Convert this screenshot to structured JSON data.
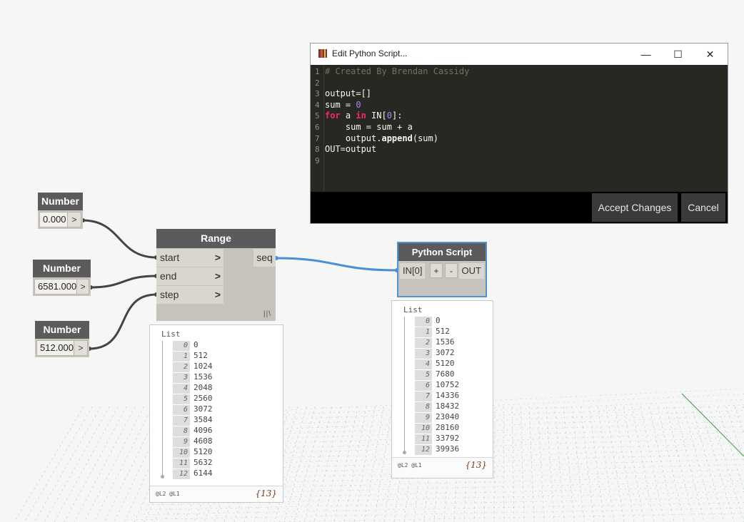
{
  "number_nodes": [
    {
      "title": "Number",
      "value": "0.000",
      "arrow": ">"
    },
    {
      "title": "Number",
      "value": "6581.000",
      "arrow": ">"
    },
    {
      "title": "Number",
      "value": "512.000",
      "arrow": ">"
    }
  ],
  "range_node": {
    "title": "Range",
    "inputs": [
      "start",
      "end",
      "step"
    ],
    "chevron": ">",
    "output": "seq",
    "lacing": "||\\"
  },
  "range_preview": {
    "title": "List",
    "items": [
      {
        "idx": "0",
        "val": "0"
      },
      {
        "idx": "1",
        "val": "512"
      },
      {
        "idx": "2",
        "val": "1024"
      },
      {
        "idx": "3",
        "val": "1536"
      },
      {
        "idx": "4",
        "val": "2048"
      },
      {
        "idx": "5",
        "val": "2560"
      },
      {
        "idx": "6",
        "val": "3072"
      },
      {
        "idx": "7",
        "val": "3584"
      },
      {
        "idx": "8",
        "val": "4096"
      },
      {
        "idx": "9",
        "val": "4608"
      },
      {
        "idx": "10",
        "val": "5120"
      },
      {
        "idx": "11",
        "val": "5632"
      },
      {
        "idx": "12",
        "val": "6144"
      }
    ],
    "levels": "@L2 @L1",
    "count": "{13}"
  },
  "python_node": {
    "title": "Python Script",
    "input": "IN[0]",
    "add": "+",
    "remove": "-",
    "output": "OUT"
  },
  "python_preview": {
    "title": "List",
    "items": [
      {
        "idx": "0",
        "val": "0"
      },
      {
        "idx": "1",
        "val": "512"
      },
      {
        "idx": "2",
        "val": "1536"
      },
      {
        "idx": "3",
        "val": "3072"
      },
      {
        "idx": "4",
        "val": "5120"
      },
      {
        "idx": "5",
        "val": "7680"
      },
      {
        "idx": "6",
        "val": "10752"
      },
      {
        "idx": "7",
        "val": "14336"
      },
      {
        "idx": "8",
        "val": "18432"
      },
      {
        "idx": "9",
        "val": "23040"
      },
      {
        "idx": "10",
        "val": "28160"
      },
      {
        "idx": "11",
        "val": "33792"
      },
      {
        "idx": "12",
        "val": "39936"
      }
    ],
    "levels": "@L2 @L1",
    "count": "{13}"
  },
  "editor": {
    "title": "Edit Python Script...",
    "controls": {
      "minimize": "—",
      "maximize": "☐",
      "close": "✕"
    },
    "line_numbers": [
      "1",
      "2",
      "3",
      "4",
      "5",
      "6",
      "7",
      "8",
      "9"
    ],
    "code": {
      "l1": "# Created By Brendan Cassidy",
      "l3": "output=[]",
      "l4a": "sum = ",
      "l4b": "0",
      "l5a": "for",
      "l5b": " a ",
      "l5c": "in",
      "l5d": " IN[",
      "l5e": "0",
      "l5f": "]:",
      "l6": "    sum = sum + a",
      "l7a": "    output.",
      "l7b": "append",
      "l7c": "(sum)",
      "l8": "OUT=output"
    },
    "accept_label": "Accept Changes",
    "cancel_label": "Cancel"
  },
  "colors": {
    "wire_dark": "#444444",
    "wire_selected": "#4a90d9",
    "node_header": "#5b5b5b",
    "grid": "#7f9fc0"
  }
}
